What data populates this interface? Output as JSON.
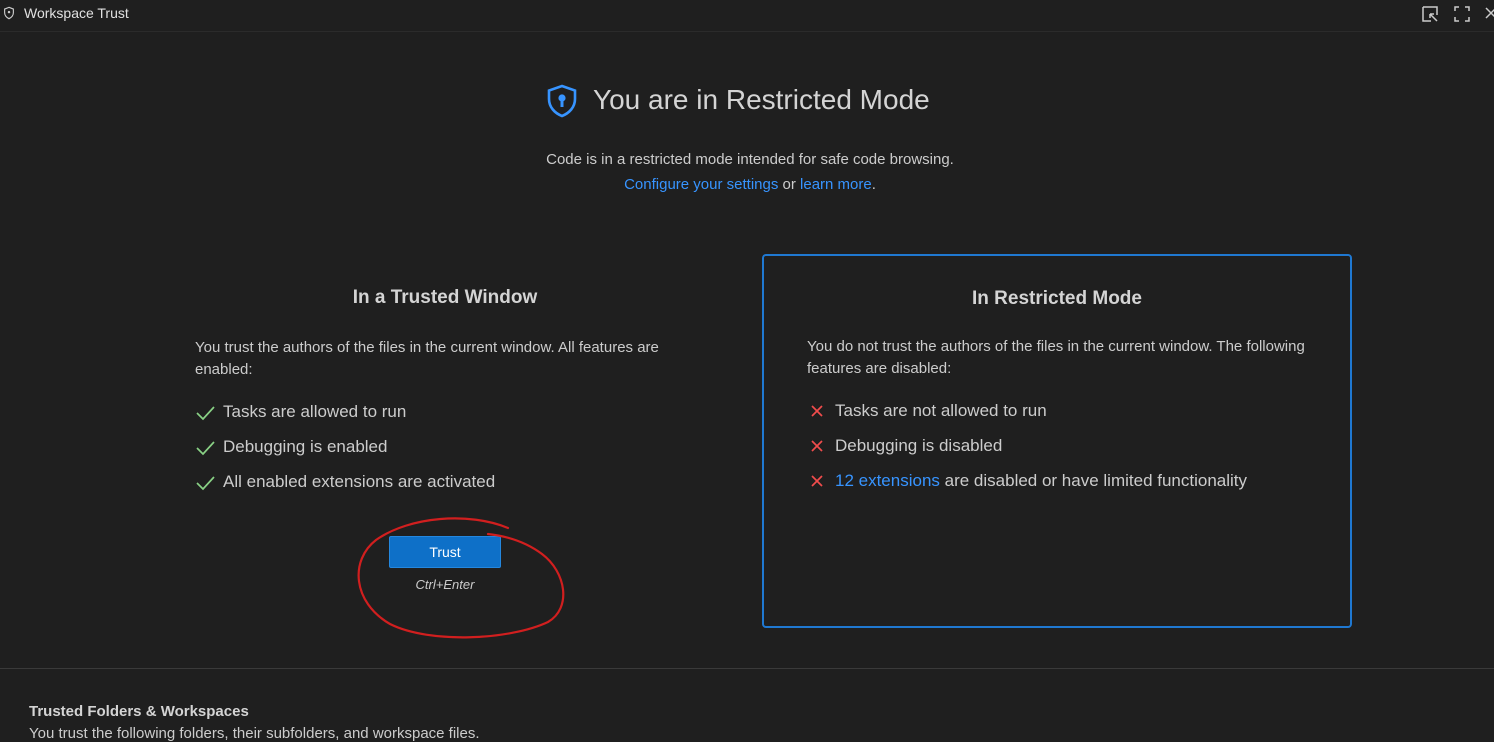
{
  "tab": {
    "title": "Workspace Trust",
    "icon": "shield-icon",
    "actions": [
      "open-in-window-icon",
      "maximize-icon",
      "close-icon"
    ]
  },
  "hero": {
    "icon": "shield-lock-icon",
    "title": "You are in Restricted Mode",
    "subtitle": "Code is in a restricted mode intended for safe code browsing.",
    "link_settings": "Configure your settings",
    "or": " or ",
    "link_learn": "learn more",
    "period": "."
  },
  "trusted": {
    "heading": "In a Trusted Window",
    "description": "You trust the authors of the files in the current window. All features are enabled:",
    "items": [
      {
        "text": "Tasks are allowed to run",
        "icon": "check-icon"
      },
      {
        "text": "Debugging is enabled",
        "icon": "check-icon"
      },
      {
        "text": "All enabled extensions are activated",
        "icon": "check-icon"
      }
    ],
    "button_label": "Trust",
    "button_hint": "Ctrl+Enter"
  },
  "restricted": {
    "heading": "In Restricted Mode",
    "description": "You do not trust the authors of the files in the current window. The following features are disabled:",
    "items": [
      {
        "text": "Tasks are not allowed to run",
        "icon": "x-icon"
      },
      {
        "text": "Debugging is disabled",
        "icon": "x-icon"
      },
      {
        "link": "12 extensions",
        "text": " are disabled or have limited functionality",
        "icon": "x-icon"
      }
    ]
  },
  "folders": {
    "title": "Trusted Folders & Workspaces",
    "description": "You trust the following folders, their subfolders, and workspace files."
  },
  "colors": {
    "background": "#1f1f1f",
    "accent": "#0e70c8",
    "link": "#3794ff",
    "check": "#89d185",
    "cross": "#f14c4c",
    "annotation": "#d11f1f"
  }
}
